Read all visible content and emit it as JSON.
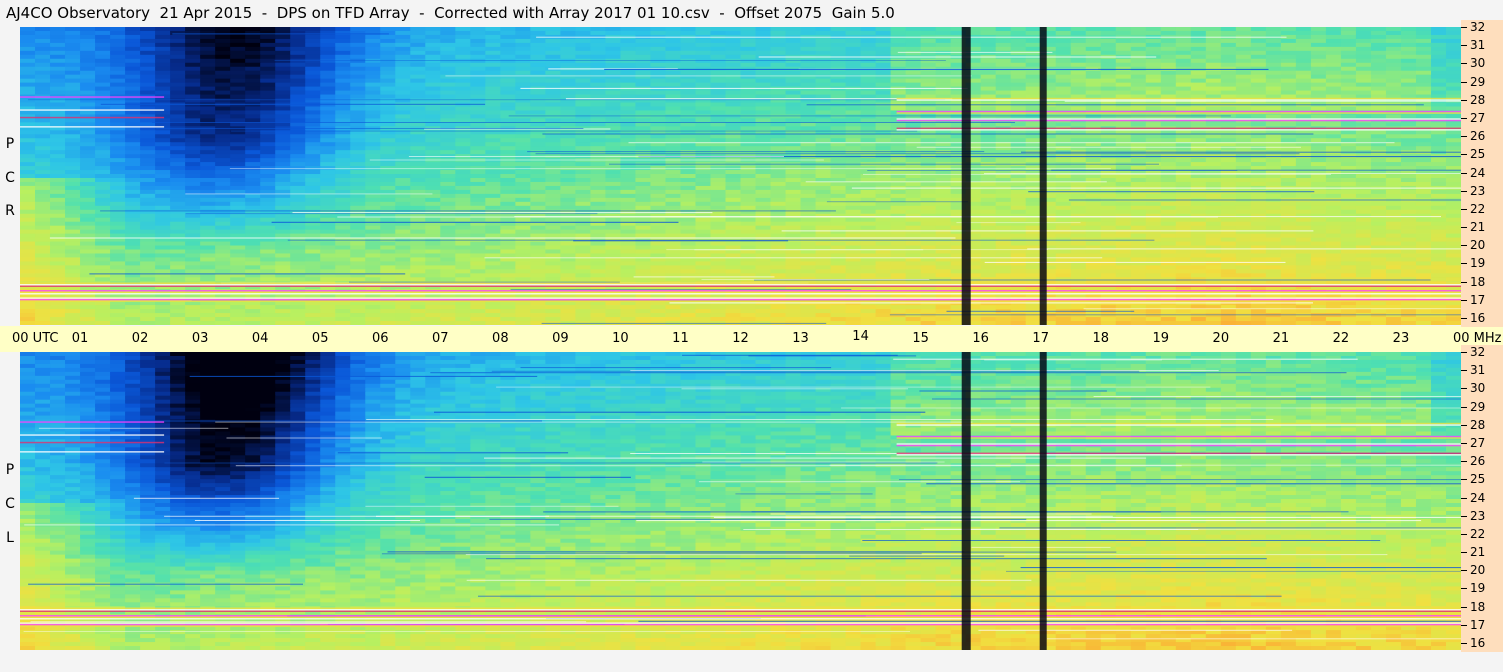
{
  "title": "AJ4CO Observatory  21 Apr 2015  -  DPS on TFD Array  -  Corrected with Array 2017 01 10.csv  -  Offset 2075  Gain 5.0",
  "panels": [
    {
      "id": "rcp",
      "label_letters": [
        "P",
        "C",
        "R"
      ]
    },
    {
      "id": "lcp",
      "label_letters": [
        "P",
        "C",
        "L"
      ]
    }
  ],
  "time_axis": {
    "labels": [
      "00 UTC",
      "01",
      "02",
      "03",
      "04",
      "05",
      "06",
      "07",
      "08",
      "09",
      "10",
      "11",
      "12",
      "13",
      "14",
      "15",
      "16",
      "17",
      "18",
      "19",
      "20",
      "21",
      "22",
      "23",
      "00 MHz"
    ]
  },
  "freq_axis": {
    "labels": [
      "32",
      "31",
      "30",
      "29",
      "28",
      "27",
      "26",
      "25",
      "24",
      "23",
      "22",
      "21",
      "20",
      "19",
      "18",
      "17",
      "16"
    ]
  },
  "colors": {
    "background": "#f4f4f4",
    "time_axis_bg": "#ffffc6",
    "freq_axis_bg": "#fedebd",
    "colormap": [
      "#000010",
      "#062a8a",
      "#0a57d8",
      "#1a8cf0",
      "#2ec6e6",
      "#4fe0b0",
      "#b8f060",
      "#f0e040",
      "#ff9a30",
      "#e03070",
      "#ff40ff",
      "#ffffff"
    ]
  },
  "chart_data": {
    "type": "heatmap",
    "title": "AJ4CO Observatory  21 Apr 2015  -  DPS on TFD Array  -  Corrected with Array 2017 01 10.csv  -  Offset 2075  Gain 5.0",
    "x_range": [
      0,
      24
    ],
    "x_unit": "UTC",
    "y_range": [
      16,
      32
    ],
    "y_unit": "MHz",
    "panels": [
      "RCP",
      "LCP"
    ],
    "dark_vertical_bands_utc": [
      15.75,
      17.05
    ],
    "interference_bands_mhz": [
      17.4,
      17.8,
      18.2,
      26.6,
      27.1,
      27.5,
      28.2
    ]
  }
}
